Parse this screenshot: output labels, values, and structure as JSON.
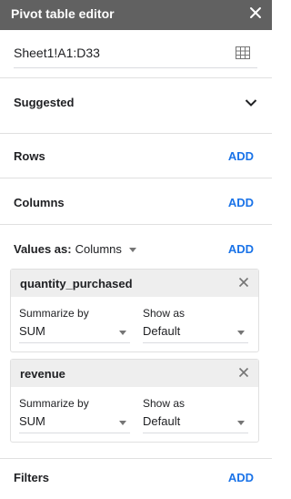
{
  "header": {
    "title": "Pivot table editor"
  },
  "range": {
    "value": "Sheet1!A1:D33"
  },
  "suggested": {
    "label": "Suggested"
  },
  "rows": {
    "label": "Rows",
    "add_label": "ADD"
  },
  "columns": {
    "label": "Columns",
    "add_label": "ADD"
  },
  "values": {
    "label": "Values as:",
    "mode": "Columns",
    "add_label": "ADD",
    "cards": [
      {
        "title": "quantity_purchased",
        "summarize_label": "Summarize by",
        "summarize_value": "SUM",
        "show_label": "Show as",
        "show_value": "Default"
      },
      {
        "title": "revenue",
        "summarize_label": "Summarize by",
        "summarize_value": "SUM",
        "show_label": "Show as",
        "show_value": "Default"
      }
    ]
  },
  "filters": {
    "label": "Filters",
    "add_label": "ADD"
  },
  "colors": {
    "header_bg": "#616161",
    "accent": "#1a73e8"
  }
}
